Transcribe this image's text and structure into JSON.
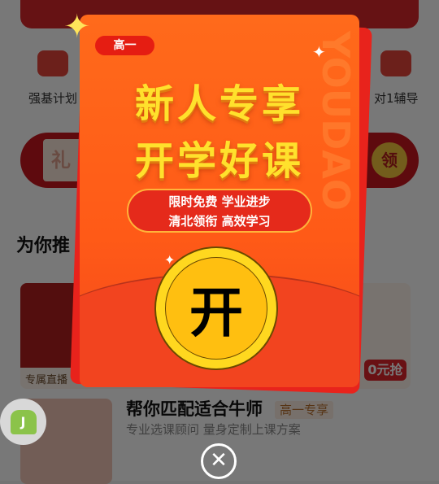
{
  "page": {
    "icons": [
      {
        "label": "强基计划"
      },
      {
        "label": "对1辅导"
      }
    ],
    "gift": {
      "left_char": "礼",
      "button": "领"
    },
    "section_title": "为你推",
    "card1": {
      "label": "专属直播",
      "badge": "0元抢"
    },
    "card2": {
      "title": "帮你匹配适合牛师",
      "tag": "高一专享",
      "subtitle": "专业选课顾问 量身定制上课方案"
    }
  },
  "popup": {
    "grade": "高一",
    "title_line1": "新人专享",
    "title_line2": "开学好课",
    "slogan_line1": "限时免费 学业进步",
    "slogan_line2": "清北领衔 高效学习",
    "coin_char": "开",
    "watermark": "YOUDAO",
    "close": "✕"
  },
  "colors": {
    "accent": "#ff5a17",
    "gold": "#ffd81f",
    "overlay": "rgba(0,0,0,0.58)"
  }
}
